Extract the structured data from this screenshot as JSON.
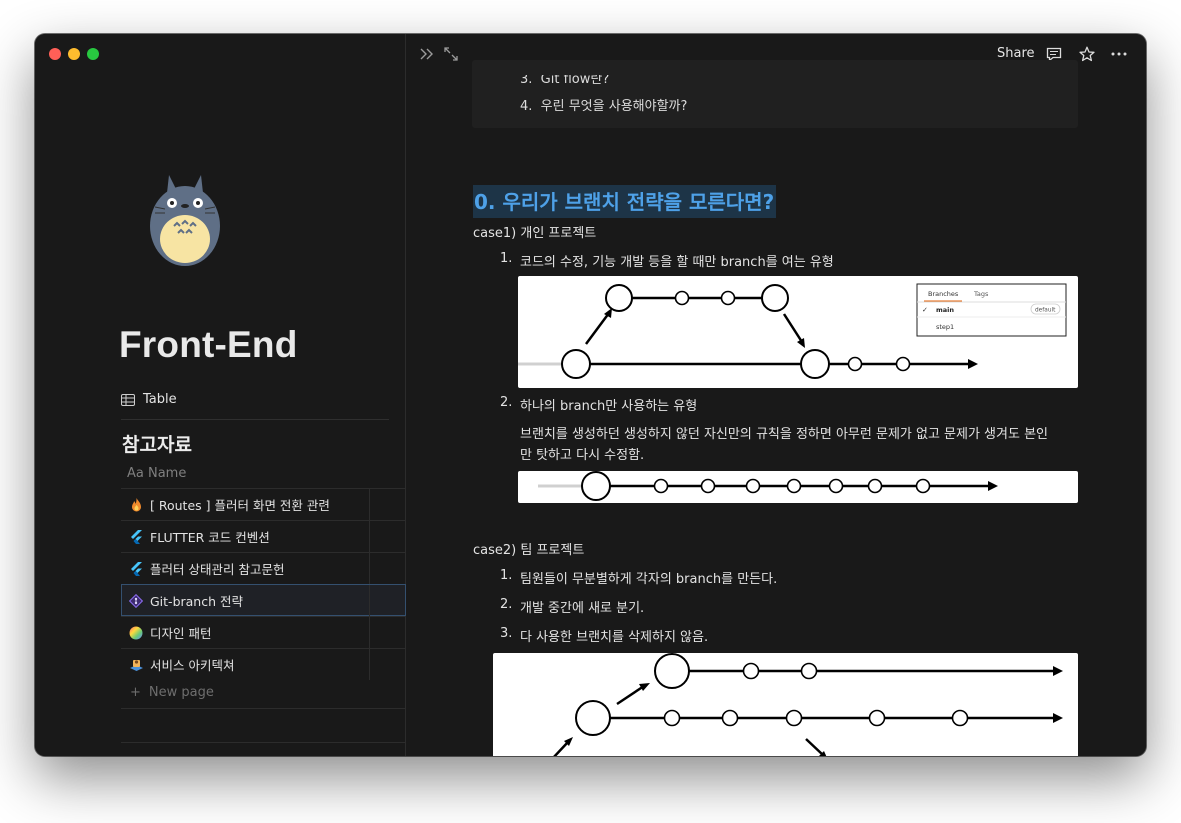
{
  "sidebar": {
    "page_title": "Front-End",
    "view_tab_label": "Table",
    "database_title": "참고자료",
    "column_name_label": "Aa Name",
    "rows": [
      {
        "label": "[ Routes ] 플러터 화면 전환 관련",
        "icon": "fire-icon"
      },
      {
        "label": "FLUTTER 코드 컨벤션",
        "icon": "flutter-icon"
      },
      {
        "label": "플러터 상태관리 참고문헌",
        "icon": "flutter-icon"
      },
      {
        "label": "Git-branch 전략",
        "icon": "git-icon",
        "selected": true
      },
      {
        "label": "디자인 패턴",
        "icon": "color-wheel-icon"
      },
      {
        "label": "서비스 아키텍쳐",
        "icon": "server-icon"
      }
    ],
    "new_page_label": "New page"
  },
  "topbar": {
    "share_label": "Share"
  },
  "doc": {
    "toc": [
      {
        "num": "3.",
        "text": "Git flow란?"
      },
      {
        "num": "4.",
        "text": "우린 무엇을 사용해야할까?"
      }
    ],
    "heading": "0. 우리가 브랜치 전략을 모른다면?",
    "case1": {
      "label": "case1) 개인 프로젝트",
      "items": [
        {
          "num": "1.",
          "text": "코드의 수정, 기능 개발 등을 할 때만 branch를 여는 유형"
        },
        {
          "num": "2.",
          "text": "하나의 branch만 사용하는 유형"
        }
      ],
      "paragraph_line1": "브랜치를 생성하던 생성하지 않던 자신만의 규칙을 정하면 아무런 문제가 없고 문제가 생겨도 본인",
      "paragraph_line2": "만 탓하고 다시 수정함.",
      "branch_menu": {
        "tab_branches": "Branches",
        "tab_tags": "Tags",
        "item_main": "main",
        "item_main_badge": "default",
        "item_step": "step1"
      }
    },
    "case2": {
      "label": "case2) 팀 프로젝트",
      "items": [
        {
          "num": "1.",
          "text": "팀원들이 무분별하게 각자의 branch를 만든다."
        },
        {
          "num": "2.",
          "text": "개발 중간에 새로 분기."
        },
        {
          "num": "3.",
          "text": "다 사용한 브랜치를 삭제하지 않음."
        }
      ]
    }
  },
  "colors": {
    "heading_text": "#4ea1e8",
    "heading_bg": "#1d3447"
  }
}
